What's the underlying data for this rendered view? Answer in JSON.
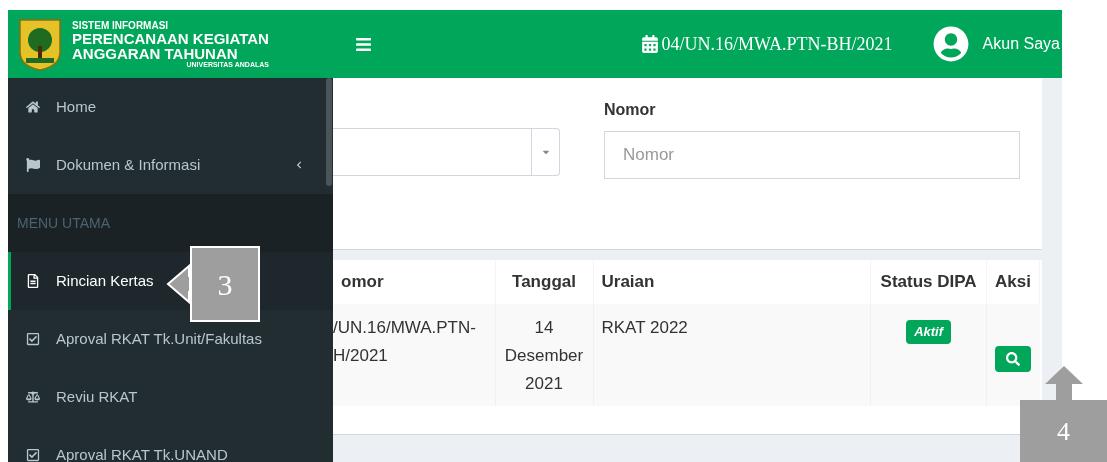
{
  "brand": {
    "line1": "SISTEM INFORMASI",
    "line2": "PERENCANAAN KEGIATAN",
    "line3": "ANGGARAN TAHUNAN",
    "line4": "UNIVERSITAS ANDALAS"
  },
  "topbar": {
    "period": "04/UN.16/MWA.PTN-BH/2021",
    "account": "Akun Saya"
  },
  "sidebar": {
    "items": [
      {
        "kind": "link",
        "label": "Home",
        "selected": false,
        "submenu": false
      },
      {
        "kind": "link",
        "label": "Dokumen & Informasi",
        "selected": false,
        "submenu": true
      },
      {
        "kind": "header",
        "label": "MENU UTAMA"
      },
      {
        "kind": "link",
        "label": "Rincian Kertas",
        "selected": true,
        "submenu": false
      },
      {
        "kind": "link",
        "label": "Aproval RKAT Tk.Unit/Fakultas",
        "selected": false,
        "submenu": false
      },
      {
        "kind": "link",
        "label": "Reviu RKAT",
        "selected": false,
        "submenu": false
      },
      {
        "kind": "link",
        "label": "Aproval RKAT Tk.UNAND",
        "selected": false,
        "submenu": false
      }
    ]
  },
  "filter": {
    "nomor": {
      "label": "Nomor",
      "placeholder": "Nomor"
    }
  },
  "table": {
    "columns": [
      "omor",
      "Tanggal",
      "Uraian",
      "Status DIPA",
      "Aksi"
    ],
    "rows": [
      {
        "nomor": [
          "/UN.16/MWA.PTN-",
          "H/2021"
        ],
        "tanggal": "14 Desember 2021",
        "uraian": "RKAT 2022",
        "status": "Aktif"
      }
    ]
  },
  "callouts": [
    {
      "number": "3",
      "kind": "leftarrow"
    },
    {
      "number": "4",
      "kind": "uparrow"
    }
  ]
}
